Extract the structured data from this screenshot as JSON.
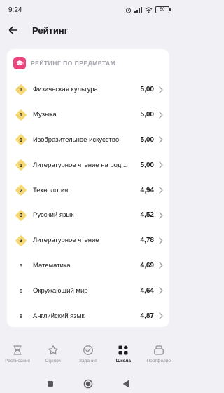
{
  "status_bar": {
    "time": "9:24",
    "battery": "50"
  },
  "header": {
    "title": "Рейтинг"
  },
  "card": {
    "title": "РЕЙТИНГ ПО ПРЕДМЕТАМ",
    "icon_color": "#e8467c",
    "subjects": [
      {
        "rank": "1",
        "name": "Физическая культура",
        "score": "5,00",
        "medal": true
      },
      {
        "rank": "1",
        "name": "Музыка",
        "score": "5,00",
        "medal": true
      },
      {
        "rank": "1",
        "name": "Изобразительное искусство",
        "score": "5,00",
        "medal": true
      },
      {
        "rank": "1",
        "name": "Литературное чтение на род...",
        "score": "5,00",
        "medal": true
      },
      {
        "rank": "2",
        "name": "Технология",
        "score": "4,94",
        "medal": true
      },
      {
        "rank": "3",
        "name": "Русский язык",
        "score": "4,52",
        "medal": true
      },
      {
        "rank": "3",
        "name": "Литературное чтение",
        "score": "4,78",
        "medal": true
      },
      {
        "rank": "5",
        "name": "Математика",
        "score": "4,69",
        "medal": false
      },
      {
        "rank": "6",
        "name": "Окружающий мир",
        "score": "4,64",
        "medal": false
      },
      {
        "rank": "8",
        "name": "Английский язык",
        "score": "4,87",
        "medal": false
      }
    ]
  },
  "bottom_nav": {
    "items": [
      {
        "label": "Расписание",
        "icon": "schedule-icon",
        "active": false
      },
      {
        "label": "Оценки",
        "icon": "star-icon",
        "active": false
      },
      {
        "label": "Задания",
        "icon": "check-circle-icon",
        "active": false
      },
      {
        "label": "Школа",
        "icon": "school-grid-icon",
        "active": true
      },
      {
        "label": "Портфолио",
        "icon": "portfolio-icon",
        "active": false
      }
    ]
  },
  "colors": {
    "medal": "#f6d873",
    "accent": "#e8467c",
    "background": "#f0f0f5"
  }
}
